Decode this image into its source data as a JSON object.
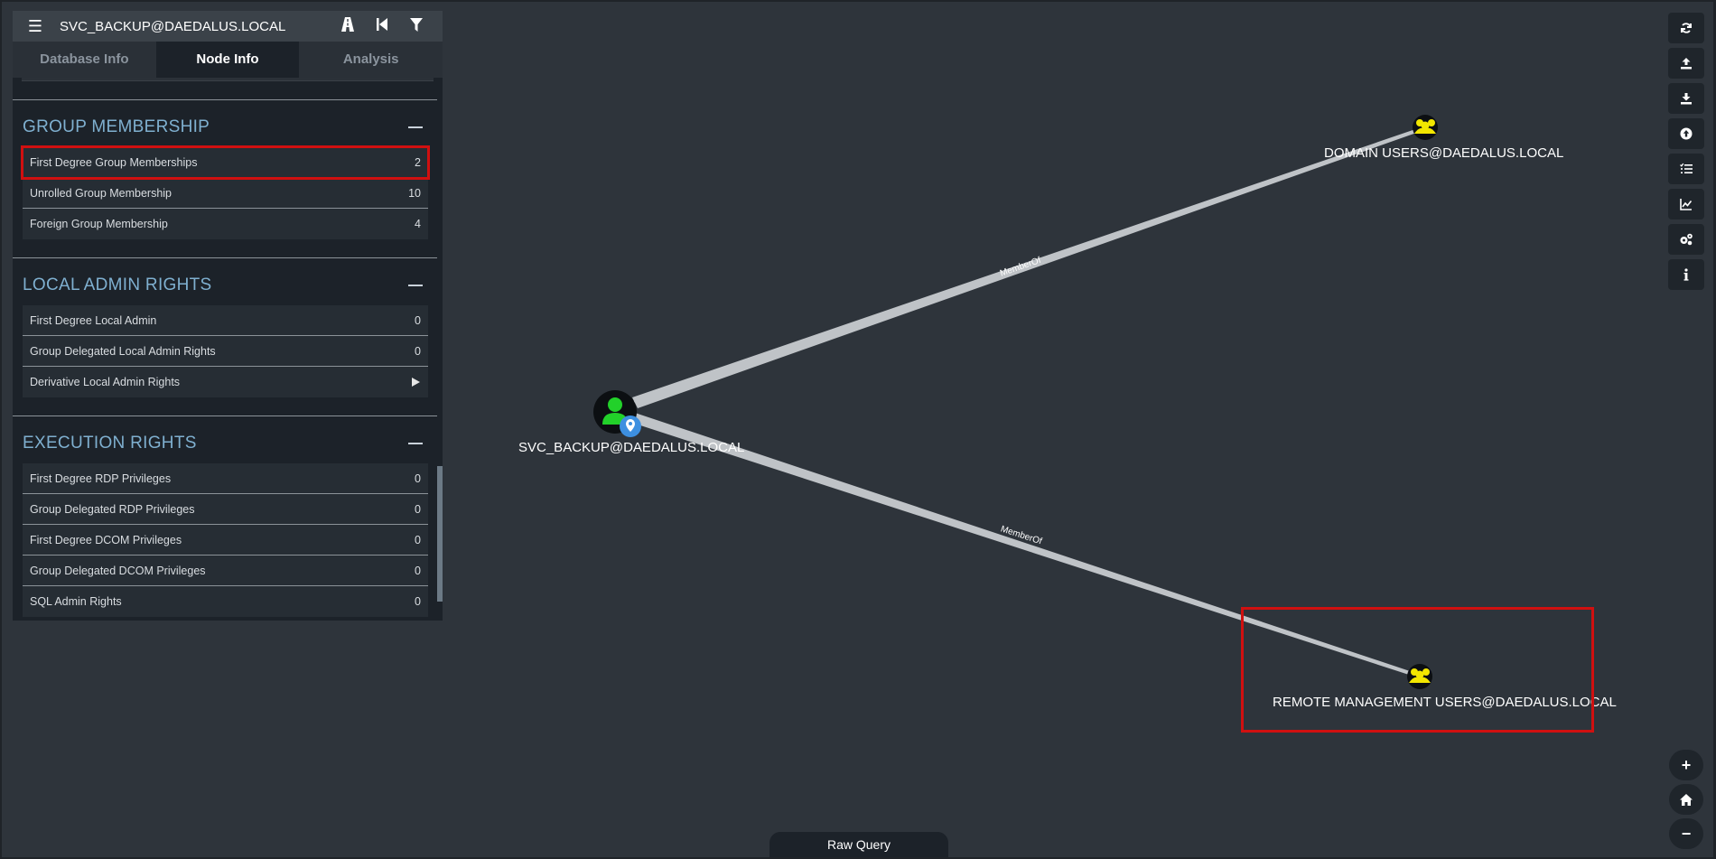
{
  "header": {
    "title": "SVC_BACKUP@DAEDALUS.LOCAL",
    "icons": [
      "menu-icon",
      "path-icon",
      "back-icon",
      "filter-icon"
    ]
  },
  "tabs": [
    {
      "label": "Database Info",
      "active": false
    },
    {
      "label": "Node Info",
      "active": true
    },
    {
      "label": "Analysis",
      "active": false
    }
  ],
  "sections": {
    "group_membership": {
      "title": "GROUP MEMBERSHIP",
      "rows": [
        {
          "label": "First Degree Group Memberships",
          "value": "2"
        },
        {
          "label": "Unrolled Group Membership",
          "value": "10"
        },
        {
          "label": "Foreign Group Membership",
          "value": "4"
        }
      ]
    },
    "local_admin": {
      "title": "LOCAL ADMIN RIGHTS",
      "rows": [
        {
          "label": "First Degree Local Admin",
          "value": "0"
        },
        {
          "label": "Group Delegated Local Admin Rights",
          "value": "0"
        },
        {
          "label": "Derivative Local Admin Rights",
          "value": ""
        }
      ]
    },
    "execution": {
      "title": "EXECUTION RIGHTS",
      "rows": [
        {
          "label": "First Degree RDP Privileges",
          "value": "0"
        },
        {
          "label": "Group Delegated RDP Privileges",
          "value": "0"
        },
        {
          "label": "First Degree DCOM Privileges",
          "value": "0"
        },
        {
          "label": "Group Delegated DCOM Privileges",
          "value": "0"
        },
        {
          "label": "SQL Admin Rights",
          "value": "0"
        }
      ]
    }
  },
  "graph": {
    "nodes": {
      "source": "SVC_BACKUP@DAEDALUS.LOCAL",
      "domain_users": "DOMAIN USERS@DAEDALUS.LOCAL",
      "remote_mgmt": "REMOTE MANAGEMENT USERS@DAEDALUS.LOCAL"
    },
    "edge_label": "MemberOf",
    "colors": {
      "user_node": "#22d12a",
      "group_node": "#f2e600",
      "edge": "#bfc3c7",
      "highlight": "#d01010"
    }
  },
  "toolbar": {
    "icons": [
      "refresh-icon",
      "upload-icon",
      "download-icon",
      "import-icon",
      "queries-icon",
      "stats-icon",
      "settings-icon",
      "info-icon"
    ]
  },
  "zoom": {
    "plus": "+",
    "minus": "−"
  },
  "raw_query": {
    "label": "Raw Query"
  }
}
